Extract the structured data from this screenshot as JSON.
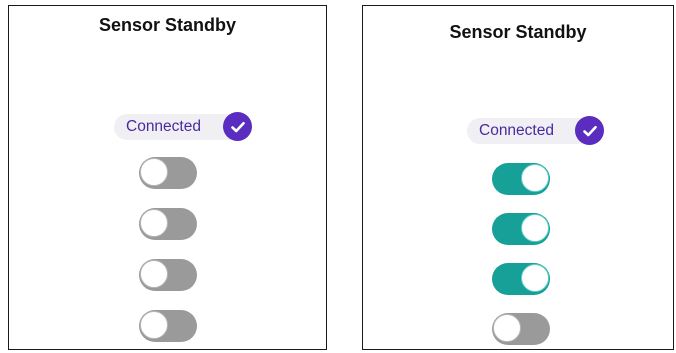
{
  "panels": [
    {
      "title": "Sensor Standby",
      "status": {
        "label": "Connected",
        "icon": "check-circle-icon"
      },
      "toggles": [
        {
          "state": "off"
        },
        {
          "state": "off"
        },
        {
          "state": "off"
        },
        {
          "state": "off"
        }
      ]
    },
    {
      "title": "Sensor Standby",
      "status": {
        "label": "Connected",
        "icon": "check-circle-icon"
      },
      "toggles": [
        {
          "state": "on"
        },
        {
          "state": "on"
        },
        {
          "state": "on"
        },
        {
          "state": "off"
        }
      ]
    }
  ],
  "colors": {
    "accent_purple": "#5a2cbf",
    "status_text": "#4b2a9e",
    "toggle_on": "#16a097",
    "toggle_off": "#9a9a9a"
  }
}
